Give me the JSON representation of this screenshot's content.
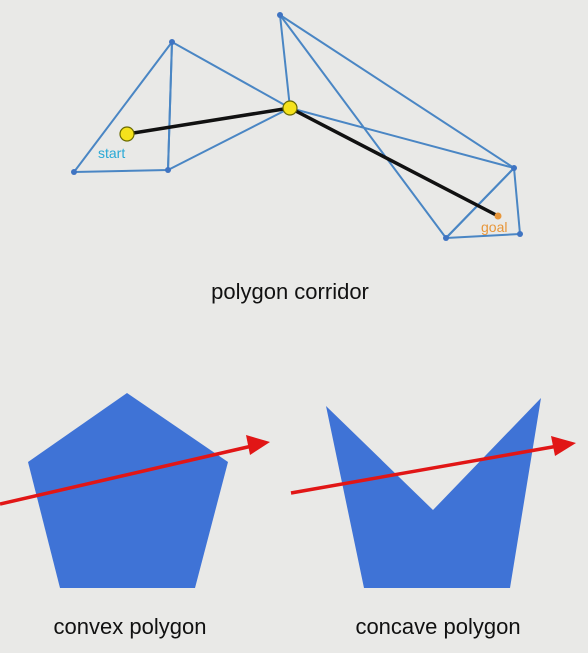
{
  "captions": {
    "corridor": "polygon corridor",
    "convex": "convex polygon",
    "concave": "concave polygon"
  },
  "labels": {
    "start": "start",
    "goal": "goal"
  },
  "colors": {
    "background": "#e9e9e7",
    "corridor_edges": "#4a86c4",
    "path": "#111111",
    "start_marker": "#f5e21c",
    "start_label": "#29a9d6",
    "goal_label": "#e8963a",
    "polygon_fill": "#3f73d6",
    "ray": "#e11616"
  },
  "icons": {
    "ray_head": "arrowhead"
  }
}
